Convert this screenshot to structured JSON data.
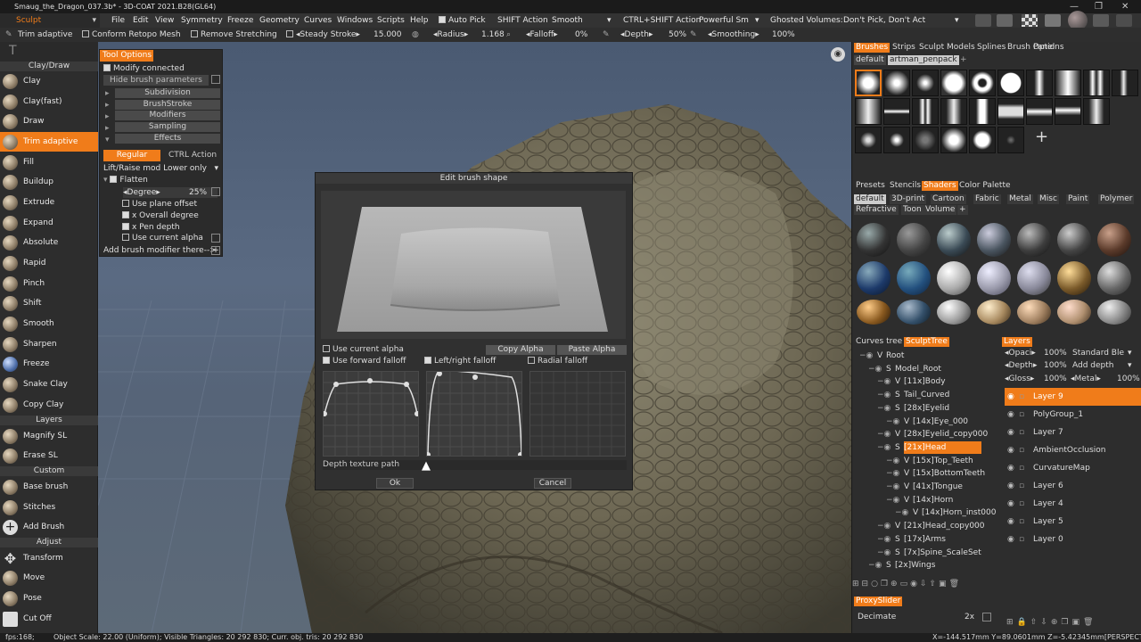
{
  "titlebar": {
    "title": "Smaug_the_Dragon_037.3b* - 3D-COAT 2021.B28(GL64)",
    "min": "—",
    "max": "❐",
    "close": "✕"
  },
  "menubar": {
    "mode": "Sculpt",
    "items": [
      "File",
      "Edit",
      "View",
      "Symmetry",
      "Freeze",
      "Geometry",
      "Curves",
      "Windows",
      "Scripts",
      "Help"
    ],
    "auto_pick": "Auto Pick",
    "shift_action": "SHIFT Action",
    "shift_value": "Smooth",
    "ctrl_shift_action": "CTRL+SHIFT Action",
    "ctrl_shift_value": "Powerful Sm",
    "ghosted_label": "Ghosted Volumes:",
    "ghosted_value": "Don't Pick, Don't Act"
  },
  "toolbar": {
    "tool": "Trim adaptive",
    "conform": "Conform Retopo Mesh",
    "remove_stretching": "Remove Stretching",
    "steady_stroke": "Steady Stroke",
    "steady_value": "15.000",
    "radius_label": "Radius",
    "radius_value": "1.168",
    "falloff_label": "Falloff",
    "falloff_value": "0%",
    "depth_label": "Depth",
    "depth_value": "50%",
    "smoothing_label": "Smoothing",
    "smoothing_value": "100%"
  },
  "leftpanel": {
    "groups": [
      {
        "header": "Clay/Draw",
        "items": [
          "Clay",
          "Clay(fast)",
          "Draw",
          "Trim adaptive",
          "Fill",
          "Buildup",
          "Extrude",
          "Expand",
          "Absolute",
          "Rapid",
          "Pinch",
          "Shift",
          "Smooth",
          "Sharpen",
          "Freeze",
          "Snake Clay",
          "Copy Clay"
        ]
      },
      {
        "header": "Layers",
        "items": [
          "Magnify SL",
          "Erase SL"
        ]
      },
      {
        "header": "Custom",
        "items": [
          "Base brush",
          "Stitches",
          "Add Brush"
        ]
      },
      {
        "header": "Adjust",
        "items": [
          "Transform",
          "Move",
          "Pose",
          "Cut Off"
        ]
      }
    ],
    "selected": "Trim adaptive"
  },
  "tool_options": {
    "title": "Tool Options",
    "modify_connected": "Modify connected",
    "hide_params": "Hide brush parameters",
    "sections": [
      "Subdivision",
      "BrushStroke",
      "Modifiers",
      "Sampling",
      "Effects"
    ],
    "regular": "Regular",
    "ctrl_action": "CTRL Action",
    "lift_raise": "Lift/Raise mod Lower only",
    "flatten": "Flatten",
    "degree_label": "Degree",
    "degree_value": "25%",
    "use_plane_offset": "Use plane offset",
    "overall_degree": "x Overall degree",
    "pen_depth": "x Pen depth",
    "use_current_alpha": "Use current alpha",
    "add_modifier": "Add brush modifier there-->"
  },
  "dialog": {
    "title": "Edit brush shape",
    "use_current_alpha": "Use current alpha",
    "copy_alpha": "Copy Alpha",
    "paste_alpha": "Paste Alpha",
    "use_forward_falloff": "Use forward falloff",
    "left_right_falloff": "Left/right falloff",
    "radial_falloff": "Radial falloff",
    "depth_texture_path": "Depth texture path",
    "ok": "Ok",
    "cancel": "Cancel"
  },
  "right_top_tabs": [
    "Brushes",
    "Strips",
    "Sculpt Models",
    "Splines",
    "Brush Options",
    "Panel"
  ],
  "brush_sets": [
    "default",
    "artman_penpack"
  ],
  "shader_tabs": [
    "Presets",
    "Stencils",
    "Shaders",
    "Color Palette"
  ],
  "shader_cats": [
    "default",
    "3D-print",
    "Cartoon",
    "Fabric",
    "Metal",
    "Misc",
    "Paint",
    "Polymer",
    "Refractive",
    "Toon",
    "Volume",
    "+"
  ],
  "tree_tabs": [
    "Curves tree",
    "SculptTree"
  ],
  "tree": [
    {
      "t": "V",
      "name": "Root",
      "lvl": 0
    },
    {
      "t": "S",
      "name": "Model_Root",
      "lvl": 1
    },
    {
      "t": "V",
      "name": "[11x]Body",
      "lvl": 2
    },
    {
      "t": "S",
      "name": "Tail_Curved",
      "lvl": 2
    },
    {
      "t": "S",
      "name": "[28x]Eyelid",
      "lvl": 2
    },
    {
      "t": "V",
      "name": "[14x]Eye_000",
      "lvl": 3
    },
    {
      "t": "V",
      "name": "[28x]Eyelid_copy000",
      "lvl": 2
    },
    {
      "t": "S",
      "name": "[21x]Head",
      "lvl": 2
    },
    {
      "t": "V",
      "name": "[15x]Top_Teeth",
      "lvl": 3
    },
    {
      "t": "V",
      "name": "[15x]BottomTeeth",
      "lvl": 3
    },
    {
      "t": "V",
      "name": "[41x]Tongue",
      "lvl": 3
    },
    {
      "t": "V",
      "name": "[14x]Horn",
      "lvl": 3
    },
    {
      "t": "V",
      "name": "[14x]Horn_inst000",
      "lvl": 4
    },
    {
      "t": "V",
      "name": "[21x]Head_copy000",
      "lvl": 2
    },
    {
      "t": "S",
      "name": "[17x]Arms",
      "lvl": 2
    },
    {
      "t": "S",
      "name": "[7x]Spine_ScaleSet",
      "lvl": 2
    },
    {
      "t": "S",
      "name": "[2x]Wings",
      "lvl": 1
    }
  ],
  "layers": {
    "title": "Layers",
    "opacity_label": "Opaci",
    "opacity_value": "100%",
    "blend_value": "Standard Ble",
    "depth_label": "Depth",
    "depth_value": "100%",
    "add_depth": "Add depth",
    "gloss_label": "Gloss",
    "gloss_value": "100%",
    "metal_label": "Metal",
    "metal_value": "100%",
    "items": [
      "Layer 9",
      "PolyGroup_1",
      "Layer 7",
      "AmbientOcclusion",
      "CurvatureMap",
      "Layer 6",
      "Layer 4",
      "Layer 5",
      "Layer 0"
    ],
    "selected": "Layer 9"
  },
  "proxy": {
    "title": "ProxySlider",
    "decimate": "Decimate",
    "decimate_value": "2x"
  },
  "status": {
    "fps": "fps:168;",
    "info": "Object Scale: 22.00 (Uniform); Visible Triangles: 20 292 830; Curr. obj. tris: 20 292 830",
    "coords": "X=-144.517mm Y=89.0601mm Z=-5.42345mm[PERSPECTIVE]"
  }
}
